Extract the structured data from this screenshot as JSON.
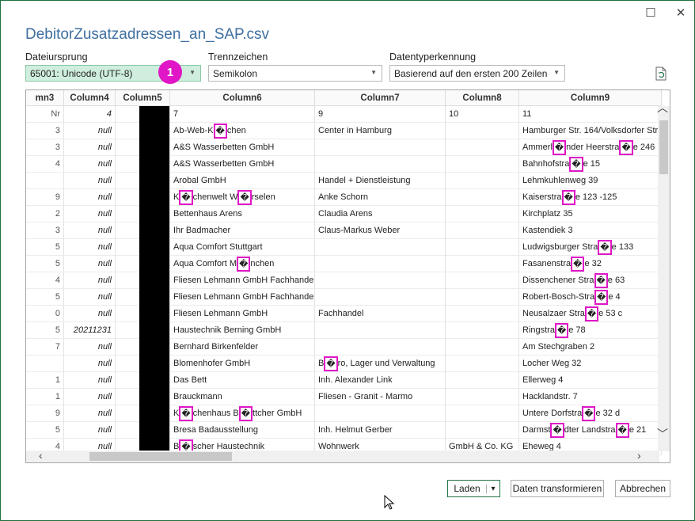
{
  "window": {
    "title": "DebitorZusatzadressen_an_SAP.csv",
    "maximize_glyph": "☐",
    "close_glyph": "✕"
  },
  "options": {
    "origin_label": "Dateiursprung",
    "origin_value": "65001: Unicode (UTF-8)",
    "delimiter_label": "Trennzeichen",
    "delimiter_value": "Semikolon",
    "type_label": "Datentyperkennung",
    "type_value": "Basierend auf den ersten 200 Zeilen"
  },
  "badge": "1",
  "table": {
    "headers": [
      "mn3",
      "Column4",
      "Column5",
      "Column6",
      "Column7",
      "Column8",
      "Column9"
    ],
    "rows": [
      [
        "Nr",
        "4",
        "",
        "7",
        "9",
        "10",
        "11"
      ],
      [
        "3",
        "null",
        "",
        "Ab-Web-K�chen",
        "Center in Hamburg",
        "",
        "Hamburger Str. 164/Volksdorfer Str"
      ],
      [
        "3",
        "null",
        "",
        "A&S Wasserbetten GmbH",
        "",
        "",
        "Ammerl�nder Heerstra�e 246"
      ],
      [
        "4",
        "null",
        "",
        "A&S Wasserbetten GmbH",
        "",
        "",
        "Bahnhofstra�e 15"
      ],
      [
        "",
        "null",
        "",
        "Arobal GmbH",
        "Handel + Dienstleistung",
        "",
        "Lehmkuhlenweg 39"
      ],
      [
        "9",
        "null",
        "",
        "K�chenwelt W�rselen",
        "Anke Schorn",
        "",
        "Kaiserstra�e 123 -125"
      ],
      [
        "2",
        "null",
        "",
        "Bettenhaus Arens",
        "Claudia Arens",
        "",
        "Kirchplatz 35"
      ],
      [
        "3",
        "null",
        "",
        "Ihr Badmacher",
        "Claus-Markus Weber",
        "",
        "Kastendiek 3"
      ],
      [
        "5",
        "null",
        "",
        "Aqua Comfort Stuttgart",
        "",
        "",
        "Ludwigsburger Stra�e 133"
      ],
      [
        "5",
        "null",
        "",
        "Aqua Comfort M�nchen",
        "",
        "",
        "Fasanenstra�e 32"
      ],
      [
        "4",
        "null",
        "",
        "Fliesen Lehmann GmbH Fachhandel",
        "",
        "",
        "Dissenchener Stra�e 63"
      ],
      [
        "5",
        "null",
        "",
        "Fliesen Lehmann GmbH Fachhandel",
        "",
        "",
        "Robert-Bosch-Stra�e 4"
      ],
      [
        "0",
        "null",
        "",
        "Fliesen Lehmann GmbH",
        "Fachhandel",
        "",
        "Neusalzaer Stra�e 53 c"
      ],
      [
        "5",
        "20211231",
        "",
        "Haustechnik Berning GmbH",
        "",
        "",
        "Ringstra�e 78"
      ],
      [
        "7",
        "null",
        "",
        "Bernhard Birkenfelder",
        "",
        "",
        "Am Stechgraben 2"
      ],
      [
        "",
        "null",
        "",
        "Blomenhofer GmbH",
        "B�ro, Lager und Verwaltung",
        "",
        "Locher Weg 32"
      ],
      [
        "1",
        "null",
        "",
        "Das Bett",
        "Inh. Alexander Link",
        "",
        "Ellerweg 4"
      ],
      [
        "1",
        "null",
        "",
        "Brauckmann",
        "Fliesen - Granit - Marmo",
        "",
        "Hacklandstr. 7"
      ],
      [
        "9",
        "null",
        "",
        "K�chenhaus B�ttcher GmbH",
        "",
        "",
        "Untere Dorfstra�e 32 d"
      ],
      [
        "5",
        "null",
        "",
        "Bresa Badausstellung",
        "Inh. Helmut Gerber",
        "",
        "Darmst�dter Landstra�e 21"
      ],
      [
        "4",
        "null",
        "",
        "B�scher Haustechnik",
        "Wohnwerk",
        "GmbH & Co. KG",
        "Eheweg 4"
      ]
    ]
  },
  "buttons": {
    "load": "Laden",
    "load_dropdown": "▾",
    "transform": "Daten transformieren",
    "cancel": "Abbrechen"
  },
  "colors": {
    "accent_title": "#3f6fa0",
    "badge": "#e016c7",
    "highlight_box": "#e016c7",
    "selected_dropdown": "#cfeedd"
  },
  "icons": [
    "refresh-preview-icon",
    "scroll-up-icon",
    "scroll-down-icon",
    "scroll-left-icon",
    "scroll-right-icon",
    "mouse-cursor-icon"
  ]
}
